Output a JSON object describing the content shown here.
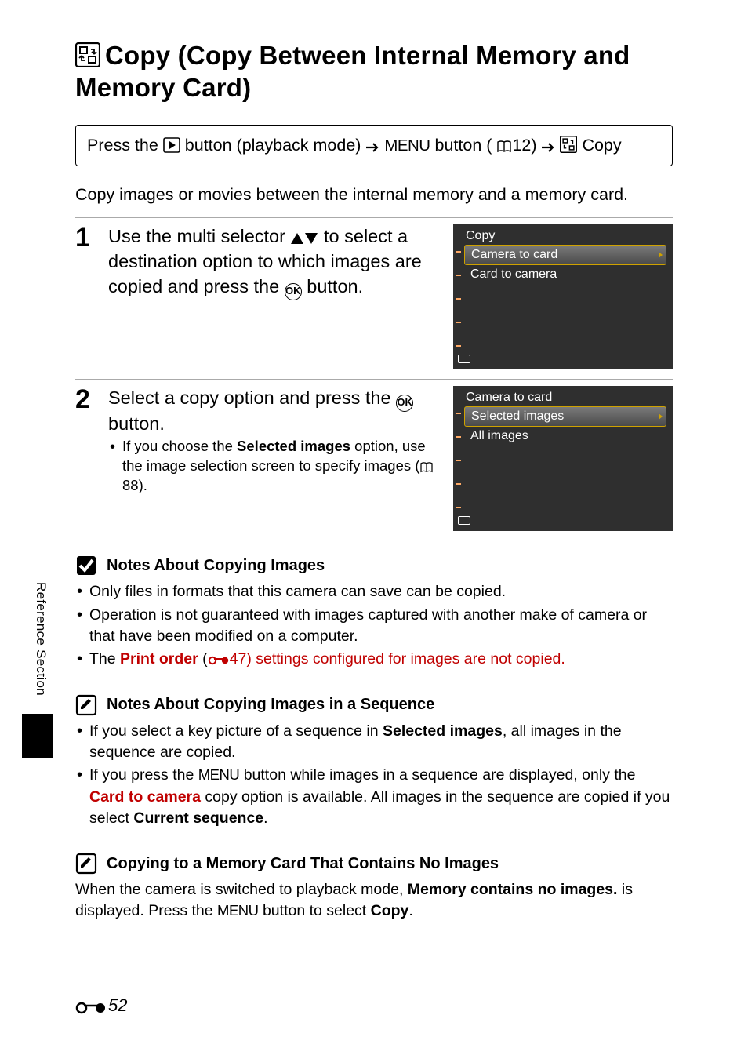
{
  "title": {
    "heading": "Copy (Copy Between Internal Memory and Memory Card)"
  },
  "pressLine": {
    "prefix": "Press the ",
    "mid1": " button (playback mode) ",
    "menu": "MENU",
    "mid2": " button (",
    "pageref1": "12) ",
    "suffix": " Copy"
  },
  "intro": "Copy images or movies between the internal memory and a memory card.",
  "step1": {
    "num": "1",
    "text_a": "Use the multi selector ",
    "text_b": " to select a destination option to which images are copied and press the ",
    "text_c": " button.",
    "lcd": {
      "title": "Copy",
      "items": [
        "Camera to card",
        "Card to camera"
      ]
    }
  },
  "step2": {
    "num": "2",
    "text_a": "Select a copy option and press the ",
    "text_b": " button.",
    "sub_a": "If you choose the ",
    "sub_bold": "Selected images",
    "sub_b": " option, use the image selection screen to specify images (",
    "sub_ref": "88).",
    "lcd": {
      "title": "Camera to card",
      "items": [
        "Selected images",
        "All images"
      ]
    }
  },
  "note1": {
    "heading": "Notes About Copying Images",
    "b1": "Only files in formats that this camera can save can be copied.",
    "b2": "Operation is not guaranteed with images captured with another make of camera or that have been modified on a computer.",
    "b3_a": "The ",
    "b3_red": "Print order",
    "b3_b": " (",
    "b3_ref": "47) settings configured for images are not copied."
  },
  "note2": {
    "heading": "Notes About Copying Images in a Sequence",
    "b1_a": "If you select a key picture of a sequence in ",
    "b1_bold": "Selected images",
    "b1_b": ", all images in the sequence are copied.",
    "b2_a": "If you press the ",
    "b2_menu": "MENU",
    "b2_b": " button while images in a sequence are displayed, only the ",
    "b2_red": "Card to camera",
    "b2_c": " copy option is available. All images in the sequence are copied if you select ",
    "b2_bold": "Current sequence",
    "b2_d": "."
  },
  "note3": {
    "heading": "Copying to a Memory Card That Contains No Images",
    "p_a": "When the camera is switched to playback mode, ",
    "p_bold": "Memory contains no images.",
    "p_b": " is displayed. Press the ",
    "p_menu": "MENU",
    "p_c": " button to select ",
    "p_bold2": "Copy",
    "p_d": "."
  },
  "side": "Reference Section",
  "pagenum": "52"
}
